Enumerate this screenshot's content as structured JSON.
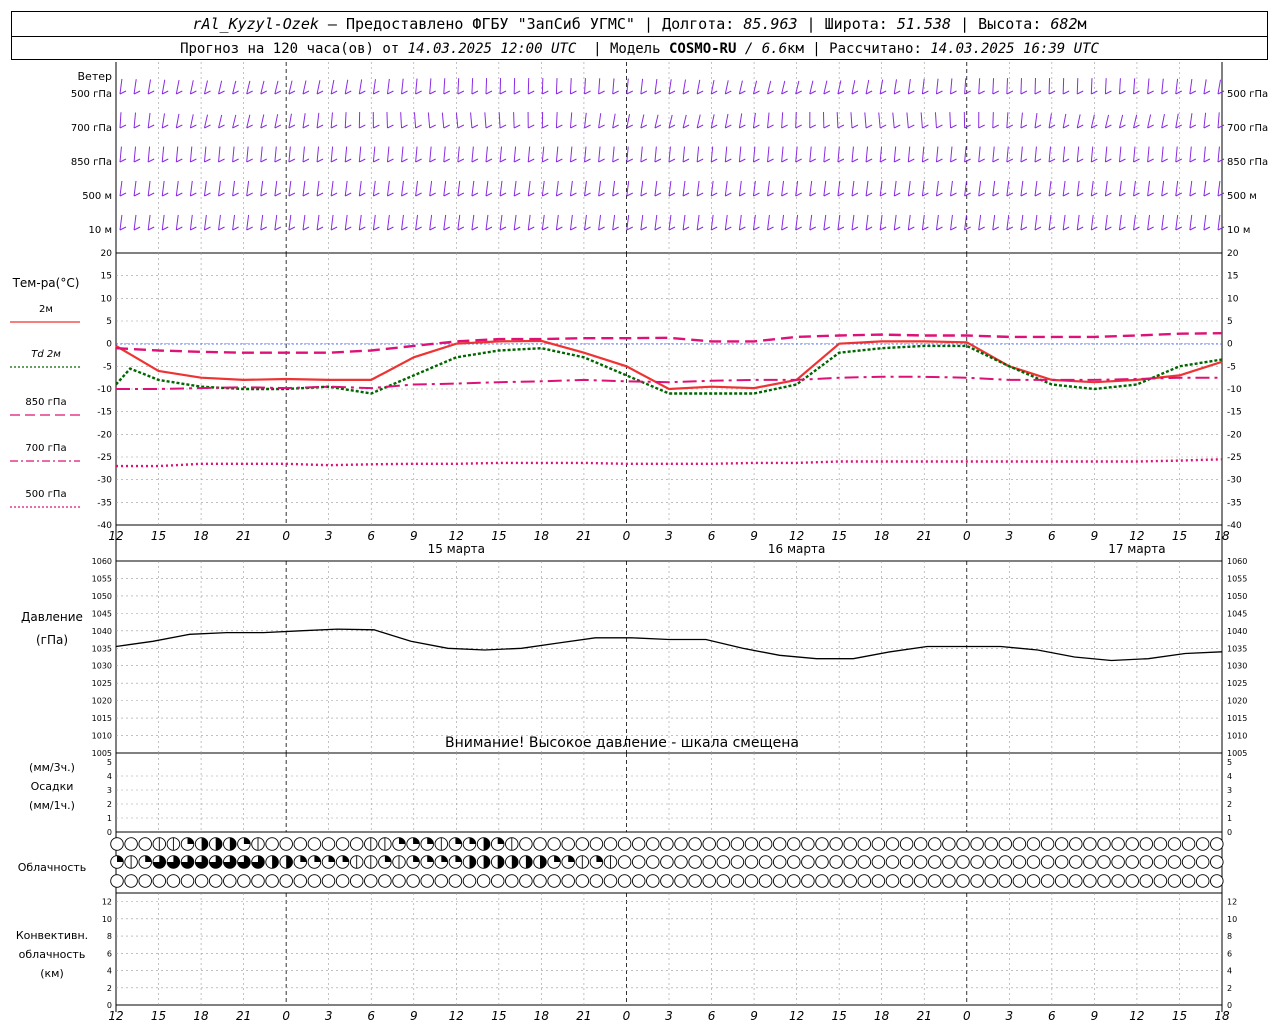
{
  "header": {
    "station": "rAl_Kyzyl-Ozek",
    "provided_by": "— Предоставлено ФГБУ \"ЗапСиб УГМС\"",
    "lon_label": "Долгота:",
    "lon_value": "85.963",
    "lat_label": "Широта:",
    "lat_value": "51.538",
    "alt_label": "Высота:",
    "alt_value": "682",
    "alt_unit": "м",
    "forecast_prefix": "Прогноз на 120 часа(ов) от",
    "forecast_time": "14.03.2025 12:00 UTC",
    "model_label": "Модель",
    "model_name": "COSMO-RU",
    "model_res": "/ 6.6",
    "model_res_unit": "км",
    "calc_label": "Рассчитано:",
    "calc_time": "14.03.2025 16:39 UTC"
  },
  "wind_panel": {
    "title": "Ветер",
    "levels": [
      "500 гПа",
      "700 гПа",
      "850 гПа",
      "500 м",
      "10  м"
    ],
    "color": "#8a2be2"
  },
  "temperature_panel": {
    "title": "Тем-ра(°C)",
    "legend": [
      {
        "label": "2м",
        "color": "#ee3333",
        "style": "solid"
      },
      {
        "label": "Td  2м",
        "color": "#006600",
        "style": "dotted"
      },
      {
        "label": "850 гПа",
        "color": "#dd1177",
        "style": "dashed"
      },
      {
        "label": "700 гПа",
        "color": "#dd1177",
        "style": "dashdot"
      },
      {
        "label": "500 гПа",
        "color": "#dd1177",
        "style": "dotted"
      }
    ],
    "y_ticks": [
      "20",
      "15",
      "10",
      "5",
      "0",
      "-5",
      "-10",
      "-15",
      "-20",
      "-25",
      "-30",
      "-35",
      "-40"
    ]
  },
  "time_axis": {
    "hour_labels": [
      "12",
      "15",
      "18",
      "21",
      "0",
      "3",
      "6",
      "9",
      "12",
      "15",
      "18",
      "21",
      "0",
      "3",
      "6",
      "9",
      "12",
      "15",
      "18",
      "21",
      "0",
      "3",
      "6",
      "9",
      "12",
      "15",
      "18"
    ],
    "date_labels": [
      "15 марта",
      "16 марта",
      "17 марта"
    ]
  },
  "pressure_panel": {
    "title": "Давление",
    "unit": "(гПа)",
    "warning": "Внимание! Высокое давление - шкала смещена",
    "y_ticks": [
      "1060",
      "1055",
      "1050",
      "1045",
      "1040",
      "1035",
      "1030",
      "1025",
      "1020",
      "1015",
      "1010",
      "1005"
    ]
  },
  "precip_panel": {
    "unit3": "(мм/3ч.)",
    "title": "Осадки",
    "unit1": "(мм/1ч.)",
    "y_ticks": [
      "5",
      "4",
      "3",
      "2",
      "1",
      "0"
    ]
  },
  "cloud_panel": {
    "title": "Облачность"
  },
  "convective_panel": {
    "title1": "Конвективн.",
    "title2": "облачность",
    "unit": "(км)",
    "y_ticks": [
      "12",
      "10",
      "8",
      "6",
      "4",
      "2",
      "0"
    ]
  },
  "chart_data": {
    "type": "line",
    "x_unit": "hours since 14.03.2025 12:00 UTC",
    "x_range": [
      0,
      78
    ],
    "temperature": {
      "ylim": [
        -40,
        20
      ],
      "series": [
        {
          "name": "2м",
          "color": "#ee3333",
          "x": [
            0,
            3,
            6,
            9,
            12,
            15,
            18,
            21,
            24,
            27,
            30,
            33,
            36,
            39,
            42,
            45,
            48,
            51,
            54,
            57,
            60,
            63,
            66,
            69,
            72,
            75,
            78
          ],
          "values": [
            -0.5,
            -6,
            -7.5,
            -8,
            -7.8,
            -8,
            -8,
            -3,
            0,
            0.5,
            0.6,
            -2,
            -5,
            -10,
            -9.5,
            -9.8,
            -8,
            0,
            0.5,
            0.5,
            0.3,
            -5,
            -8,
            -8.5,
            -8,
            -7,
            -4
          ]
        },
        {
          "name": "Td  2м",
          "color": "#006600",
          "x": [
            0,
            1,
            3,
            6,
            9,
            12,
            15,
            18,
            21,
            24,
            27,
            30,
            33,
            36,
            39,
            42,
            45,
            48,
            51,
            54,
            57,
            60,
            63,
            66,
            69,
            72,
            75,
            78
          ],
          "values": [
            -9,
            -5.5,
            -8,
            -9.5,
            -10,
            -10,
            -9.5,
            -11,
            -7,
            -3,
            -1.5,
            -1,
            -3,
            -7,
            -11,
            -11,
            -11,
            -9,
            -2,
            -1,
            -0.5,
            -0.5,
            -5,
            -9,
            -10,
            -9,
            -5,
            -3.5
          ]
        },
        {
          "name": "850 гПа",
          "color": "#dd1177",
          "x": [
            0,
            3,
            6,
            9,
            12,
            15,
            18,
            21,
            24,
            27,
            30,
            33,
            36,
            39,
            42,
            45,
            48,
            51,
            54,
            57,
            60,
            63,
            66,
            69,
            72,
            75,
            78
          ],
          "values": [
            -1,
            -1.5,
            -1.8,
            -2,
            -2,
            -2,
            -1.5,
            -0.5,
            0.5,
            1,
            1,
            1.2,
            1.2,
            1.3,
            0.5,
            0.5,
            1.5,
            1.8,
            2,
            1.8,
            1.8,
            1.5,
            1.5,
            1.5,
            1.8,
            2.2,
            2.3
          ]
        },
        {
          "name": "700 гПа",
          "color": "#dd1177",
          "x": [
            0,
            3,
            6,
            9,
            12,
            15,
            18,
            21,
            24,
            27,
            30,
            33,
            36,
            39,
            42,
            45,
            48,
            51,
            54,
            57,
            60,
            63,
            66,
            69,
            72,
            75,
            78
          ],
          "values": [
            -10,
            -10,
            -9.8,
            -9.6,
            -9.8,
            -9.5,
            -9.8,
            -9,
            -8.8,
            -8.5,
            -8.3,
            -8,
            -8.3,
            -8.5,
            -8.2,
            -8,
            -8,
            -7.5,
            -7.3,
            -7.3,
            -7.5,
            -8,
            -8,
            -8,
            -7.8,
            -7.5,
            -7.5
          ]
        },
        {
          "name": "500 гПа",
          "color": "#dd1177",
          "x": [
            0,
            3,
            6,
            9,
            12,
            15,
            18,
            21,
            24,
            27,
            30,
            33,
            36,
            39,
            42,
            45,
            48,
            51,
            54,
            57,
            60,
            63,
            66,
            69,
            72,
            75,
            78
          ],
          "values": [
            -27,
            -27,
            -26.5,
            -26.5,
            -26.5,
            -26.8,
            -26.6,
            -26.5,
            -26.5,
            -26.3,
            -26.3,
            -26.3,
            -26.5,
            -26.5,
            -26.5,
            -26.3,
            -26.3,
            -26,
            -26,
            -26,
            -26,
            -26,
            -26,
            -26,
            -26,
            -25.8,
            -25.5
          ]
        }
      ]
    },
    "pressure": {
      "ylim": [
        1005,
        1060
      ],
      "x": [
        0,
        1,
        3,
        6,
        9,
        12,
        14,
        15,
        18,
        21,
        24,
        27,
        30,
        33,
        36,
        39,
        42,
        45,
        48,
        51,
        54,
        57,
        60,
        63,
        66,
        69,
        72,
        75,
        78
      ],
      "values": [
        1035.5,
        1037,
        1039,
        1039.5,
        1039.5,
        1040,
        1040.5,
        1040.3,
        1037,
        1035,
        1034.5,
        1035,
        1036.5,
        1038,
        1038,
        1037.5,
        1037.5,
        1035,
        1033,
        1032,
        1032,
        1034,
        1035.5,
        1035.5,
        1035.5,
        1034.5,
        1032.5,
        1031.5,
        1032,
        1033.5,
        1034
      ]
    },
    "precipitation": {
      "ylim": [
        0,
        5
      ],
      "values": []
    },
    "cloudiness": {
      "rows": [
        [
          0,
          0,
          0,
          1,
          1,
          2,
          3,
          3,
          3,
          2,
          1,
          0,
          0,
          0,
          0,
          0,
          0,
          0,
          1,
          1,
          2,
          2,
          2,
          1,
          2,
          2,
          3,
          2,
          1,
          0,
          0,
          0,
          0,
          0,
          0,
          0,
          0,
          0,
          0,
          0,
          0,
          0,
          0,
          0,
          0,
          0,
          0,
          0,
          0,
          0,
          0,
          0,
          0,
          0,
          0,
          0,
          0,
          0,
          0,
          0,
          0,
          0,
          0,
          0,
          0,
          0,
          0,
          0,
          0,
          0,
          0,
          0,
          0,
          0,
          0,
          0,
          0,
          0,
          0
        ],
        [
          2,
          1,
          2,
          4,
          4,
          4,
          4,
          4,
          4,
          4,
          4,
          3,
          3,
          2,
          2,
          2,
          2,
          1,
          1,
          2,
          1,
          2,
          2,
          2,
          2,
          3,
          3,
          3,
          3,
          3,
          3,
          2,
          2,
          1,
          2,
          1,
          0,
          0,
          0,
          0,
          0,
          0,
          0,
          0,
          0,
          0,
          0,
          0,
          0,
          0,
          0,
          0,
          0,
          0,
          0,
          0,
          0,
          0,
          0,
          0,
          0,
          0,
          0,
          0,
          0,
          0,
          0,
          0,
          0,
          0,
          0,
          0,
          0,
          0,
          0,
          0,
          0,
          0,
          0
        ],
        [
          0,
          0,
          0,
          0,
          0,
          0,
          0,
          0,
          0,
          0,
          0,
          0,
          0,
          0,
          0,
          0,
          0,
          0,
          0,
          0,
          0,
          0,
          0,
          0,
          0,
          0,
          0,
          0,
          0,
          0,
          0,
          0,
          0,
          0,
          0,
          0,
          0,
          0,
          0,
          0,
          0,
          0,
          0,
          0,
          0,
          0,
          0,
          0,
          0,
          0,
          0,
          0,
          0,
          0,
          0,
          0,
          0,
          0,
          0,
          0,
          0,
          0,
          0,
          0,
          0,
          0,
          0,
          0,
          0,
          0,
          0,
          0,
          0,
          0,
          0,
          0,
          0,
          0,
          0
        ]
      ]
    },
    "convective_cloud": {
      "ylim": [
        0,
        13
      ],
      "values": []
    }
  }
}
